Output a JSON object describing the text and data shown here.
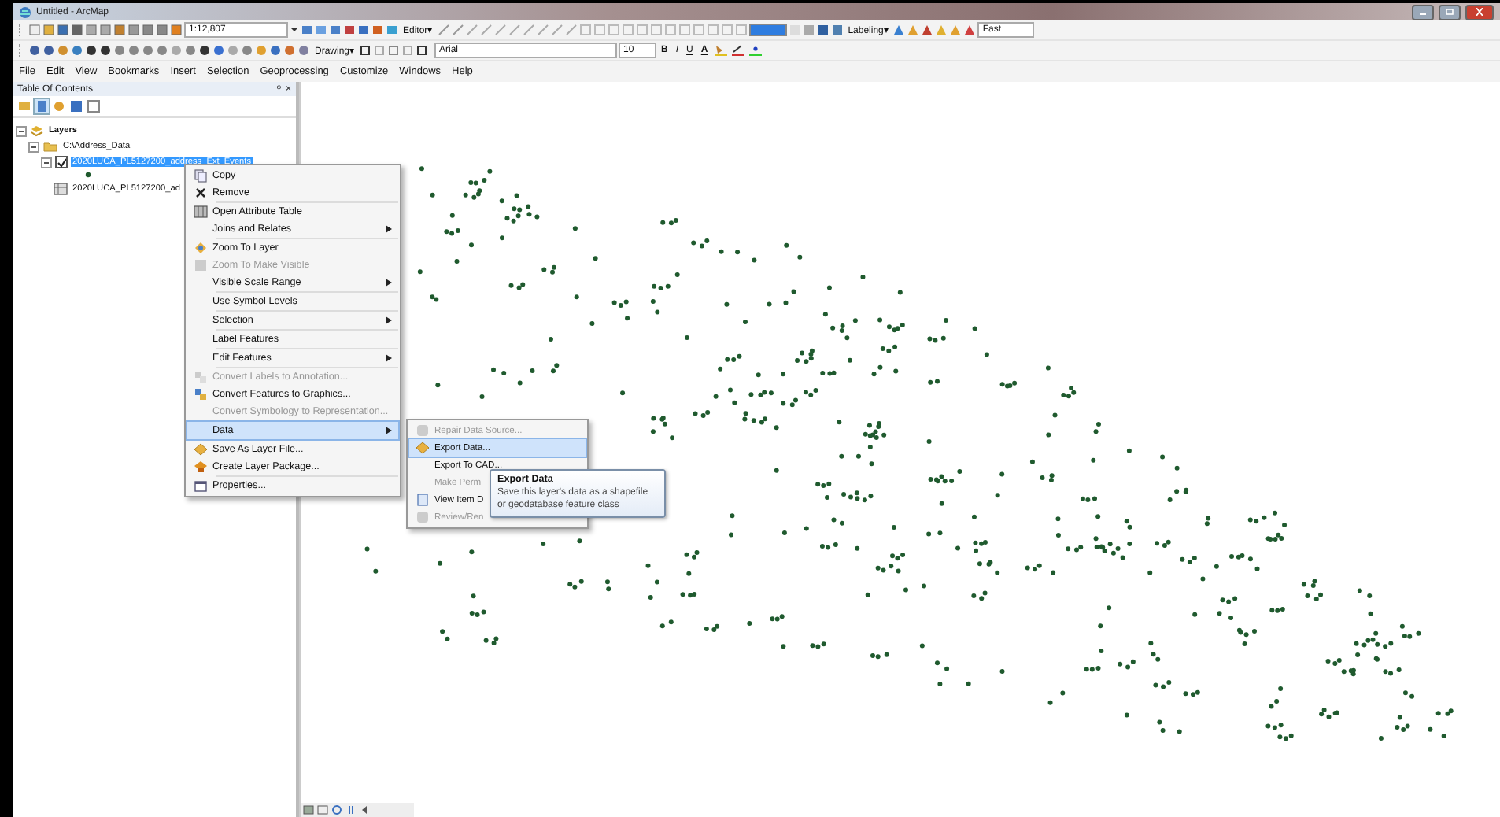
{
  "window": {
    "title": "Untitled - ArcMap"
  },
  "toolbar_1": {
    "scale": "1:12,807",
    "editor": "Editor▾",
    "labeling": "Labeling▾",
    "quality": "Fast"
  },
  "toolbar_2": {
    "drawing": "Drawing▾",
    "font": "Arial",
    "size": "10",
    "bold": "B",
    "italic": "I",
    "underline": "U",
    "font_color": "A"
  },
  "menu_bar": [
    "File",
    "Edit",
    "View",
    "Bookmarks",
    "Insert",
    "Selection",
    "Geoprocessing",
    "Customize",
    "Windows",
    "Help"
  ],
  "table_of_contents": {
    "title": "Table Of Contents",
    "pin": "ᵠ",
    "close": "×",
    "tree": [
      {
        "label": "Layers",
        "expanded": true,
        "children": [
          {
            "label": "C:\\Address_Data",
            "expanded": true,
            "children": [
              {
                "label": "2020LUCA_PL5127200_address_Ext_Events",
                "kind": "layer",
                "expanded": true,
                "checked": true,
                "selected": true
              },
              {
                "label": "2020LUCA_PL5127200_ad",
                "kind": "table",
                "selected": false
              }
            ]
          }
        ]
      }
    ]
  },
  "context_menu": [
    [
      {
        "label": "Copy",
        "kind": "copy",
        "disabled": false,
        "submenu": false,
        "selected": false
      },
      {
        "label": "Remove",
        "kind": "remove",
        "disabled": false,
        "submenu": false,
        "selected": false
      }
    ],
    [
      {
        "label": "Open Attribute Table",
        "kind": "table",
        "disabled": false,
        "submenu": false,
        "selected": false
      },
      {
        "label": "Joins and Relates",
        "disabled": false,
        "submenu": true,
        "selected": false
      }
    ],
    [
      {
        "label": "Zoom To Layer",
        "kind": "zoom",
        "disabled": false,
        "submenu": false,
        "selected": false
      },
      {
        "label": "Zoom To Make Visible",
        "kind": "zoomvis",
        "disabled": true,
        "submenu": false,
        "selected": false
      },
      {
        "label": "Visible Scale Range",
        "disabled": false,
        "submenu": true,
        "selected": false
      }
    ],
    [
      {
        "label": "Use Symbol Levels",
        "disabled": false,
        "submenu": false,
        "selected": false
      }
    ],
    [
      {
        "label": "Selection",
        "disabled": false,
        "submenu": true,
        "selected": false
      }
    ],
    [
      {
        "label": "Label Features",
        "disabled": false,
        "submenu": false,
        "selected": false
      }
    ],
    [
      {
        "label": "Edit Features",
        "disabled": false,
        "submenu": true,
        "selected": false
      }
    ],
    [
      {
        "label": "Convert Labels to Annotation...",
        "kind": "convert",
        "disabled": true,
        "submenu": false,
        "selected": false
      },
      {
        "label": "Convert Features to Graphics...",
        "kind": "convert",
        "disabled": false,
        "submenu": false,
        "selected": false
      },
      {
        "label": "Convert Symbology to Representation...",
        "disabled": true,
        "submenu": false,
        "selected": false
      }
    ],
    [
      {
        "label": "Data",
        "disabled": false,
        "submenu": true,
        "selected": true
      }
    ],
    [
      {
        "label": "Save As Layer File...",
        "kind": "diamond",
        "disabled": false,
        "submenu": false,
        "selected": false
      },
      {
        "label": "Create Layer Package...",
        "kind": "package",
        "disabled": false,
        "submenu": false,
        "selected": false
      }
    ],
    [
      {
        "label": "Properties...",
        "kind": "properties",
        "disabled": false,
        "submenu": false,
        "selected": false
      }
    ]
  ],
  "data_submenu": [
    {
      "label": "Repair Data Source...",
      "kind": "convert",
      "disabled": true,
      "selected": false
    },
    {
      "label": "Export Data...",
      "kind": "diamond",
      "disabled": false,
      "selected": true
    },
    {
      "label": "Export To CAD...",
      "disabled": false,
      "selected": false
    },
    {
      "label": "Make Perm",
      "disabled": true,
      "selected": false
    },
    {
      "label": "View Item D",
      "kind": "doc",
      "disabled": false,
      "selected": false
    },
    {
      "label": "Review/Ren",
      "kind": "convert",
      "disabled": true,
      "selected": false
    }
  ],
  "tooltip": {
    "title": "Export Data",
    "text": "Save this layer's data as a shapefile or geodatabase feature class"
  }
}
